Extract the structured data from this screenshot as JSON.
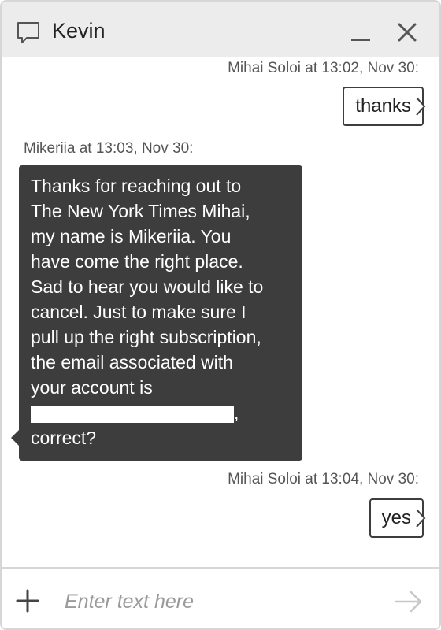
{
  "header": {
    "title": "Kevin",
    "icons": {
      "chat": "chat-bubble-icon",
      "minimize": "minimize-icon",
      "close": "close-icon"
    }
  },
  "messages": [
    {
      "sender_line": "Mihai Soloi at 13:02, Nov 30:",
      "text": "thanks",
      "direction": "outgoing"
    },
    {
      "sender_line": "Mikeriia at 13:03, Nov 30:",
      "lines": [
        "Thanks for reaching out to",
        "The New York Times Mihai,",
        "my name is Mikeriia. You",
        "have come the right place.",
        "Sad to hear you would like to",
        "cancel. Just to make sure I",
        "pull up the right subscription,",
        "the email associated with",
        "your account is",
        ",",
        "correct?"
      ],
      "direction": "incoming"
    },
    {
      "sender_line": "Mihai Soloi at 13:04, Nov 30:",
      "text": "yes",
      "direction": "outgoing"
    }
  ],
  "composer": {
    "placeholder": "Enter text here",
    "value": "",
    "icons": {
      "add": "plus-icon",
      "send": "send-arrow-icon"
    }
  },
  "colors": {
    "header_bg": "#ececec",
    "incoming_bubble": "#3d3d3d",
    "outgoing_border": "#3d3d3d",
    "border": "#d6d6d6"
  }
}
